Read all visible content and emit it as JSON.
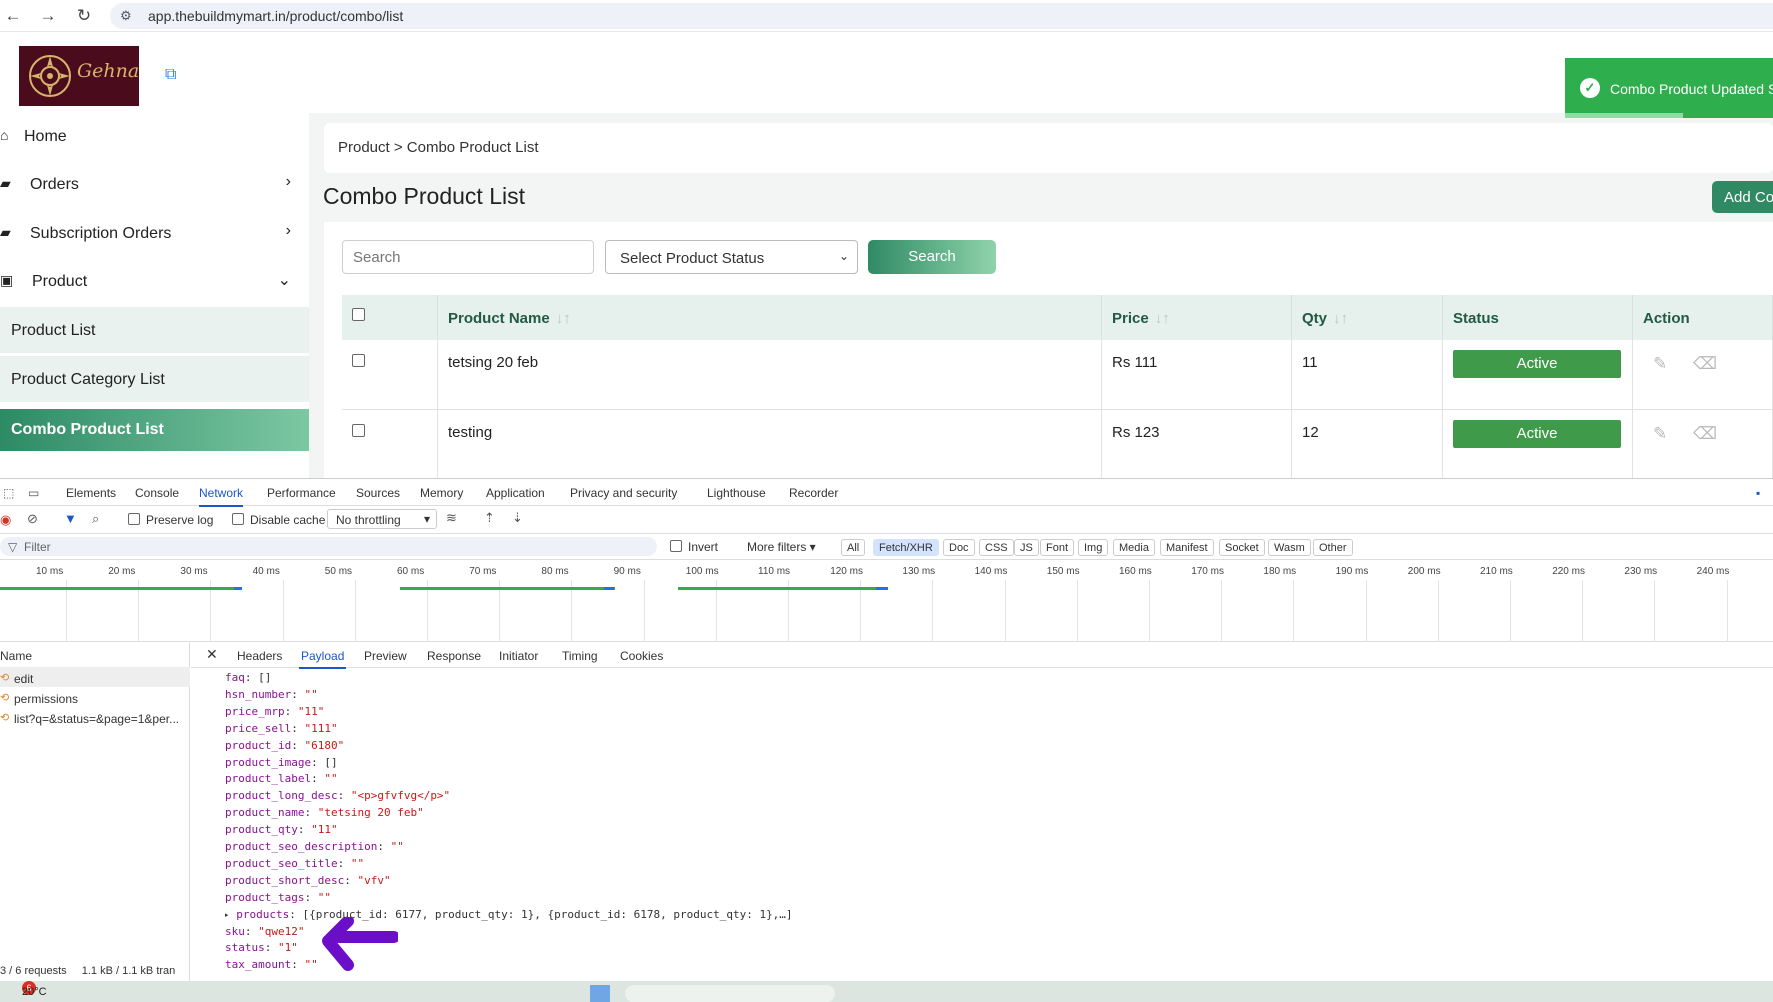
{
  "browser": {
    "url": "app.thebuildmymart.in/product/combo/list"
  },
  "logo": {
    "brand": "Gehna"
  },
  "sidebar": {
    "items": [
      {
        "label": "Home"
      },
      {
        "label": "Orders"
      },
      {
        "label": "Subscription Orders"
      },
      {
        "label": "Product"
      },
      {
        "label": "Product List"
      },
      {
        "label": "Product Category List"
      },
      {
        "label": "Combo Product List"
      }
    ]
  },
  "breadcrumb": "Product > Combo Product List",
  "page": {
    "title": "Combo Product List",
    "add_button": "Add Co"
  },
  "filters": {
    "search_placeholder": "Search",
    "status_select": "Select Product Status",
    "search_button": "Search"
  },
  "table": {
    "headers": [
      "Product Name",
      "Price",
      "Qty",
      "Status",
      "Action"
    ],
    "rows": [
      {
        "name": "tetsing 20 feb",
        "price": "Rs 111",
        "qty": "11",
        "status": "Active"
      },
      {
        "name": "testing",
        "price": "Rs 123",
        "qty": "12",
        "status": "Active"
      }
    ]
  },
  "toast": {
    "message": "Combo Product Updated S"
  },
  "devtools": {
    "tabs": [
      "Elements",
      "Console",
      "Network",
      "Performance",
      "Sources",
      "Memory",
      "Application",
      "Privacy and security",
      "Lighthouse",
      "Recorder"
    ],
    "toolbar": {
      "preserve_log": "Preserve log",
      "disable_cache": "Disable cache",
      "throttling": "No throttling"
    },
    "filter": {
      "placeholder": "Filter",
      "invert": "Invert",
      "more_filters": "More filters"
    },
    "type_chips": [
      "All",
      "Fetch/XHR",
      "Doc",
      "CSS",
      "JS",
      "Font",
      "Img",
      "Media",
      "Manifest",
      "Socket",
      "Wasm",
      "Other"
    ],
    "timeline_ticks": [
      "10 ms",
      "20 ms",
      "30 ms",
      "40 ms",
      "50 ms",
      "60 ms",
      "70 ms",
      "80 ms",
      "90 ms",
      "100 ms",
      "110 ms",
      "120 ms",
      "130 ms",
      "140 ms",
      "150 ms",
      "160 ms",
      "170 ms",
      "180 ms",
      "190 ms",
      "200 ms",
      "210 ms",
      "220 ms",
      "230 ms",
      "240 ms"
    ],
    "name_header": "Name",
    "requests": [
      "edit",
      "permissions",
      "list?q=&status=&page=1&per..."
    ],
    "status_bar": {
      "requests": "3 / 6 requests",
      "transferred": "1.1 kB / 1.1 kB tran"
    },
    "detail_tabs": [
      "Headers",
      "Payload",
      "Preview",
      "Response",
      "Initiator",
      "Timing",
      "Cookies"
    ],
    "payload": [
      {
        "key": "faq",
        "value": "[]",
        "kind": "plain"
      },
      {
        "key": "hsn_number",
        "value": "\"\"",
        "kind": "str"
      },
      {
        "key": "price_mrp",
        "value": "\"11\"",
        "kind": "str"
      },
      {
        "key": "price_sell",
        "value": "\"111\"",
        "kind": "str"
      },
      {
        "key": "product_id",
        "value": "\"6180\"",
        "kind": "str"
      },
      {
        "key": "product_image",
        "value": "[]",
        "kind": "plain"
      },
      {
        "key": "product_label",
        "value": "\"\"",
        "kind": "str"
      },
      {
        "key": "product_long_desc",
        "value": "\"<p>gfvfvg</p>\"",
        "kind": "str"
      },
      {
        "key": "product_name",
        "value": "\"tetsing 20 feb\"",
        "kind": "str"
      },
      {
        "key": "product_qty",
        "value": "\"11\"",
        "kind": "str"
      },
      {
        "key": "product_seo_description",
        "value": "\"\"",
        "kind": "str"
      },
      {
        "key": "product_seo_title",
        "value": "\"\"",
        "kind": "str"
      },
      {
        "key": "product_short_desc",
        "value": "\"vfv\"",
        "kind": "str"
      },
      {
        "key": "product_tags",
        "value": "\"\"",
        "kind": "str"
      },
      {
        "key": "products",
        "value": "[{product_id: 6177, product_qty: 1}, {product_id: 6178, product_qty: 1},…]",
        "kind": "plain"
      },
      {
        "key": "sku",
        "value": "\"qwe12\"",
        "kind": "str"
      },
      {
        "key": "status",
        "value": "\"1\"",
        "kind": "str"
      },
      {
        "key": "tax_amount",
        "value": "\"\"",
        "kind": "str"
      }
    ]
  },
  "taskbar": {
    "weather": "20°C",
    "badge": "6"
  },
  "colors": {
    "accent": "#2f8a64",
    "toast": "#2fae4e",
    "annotation_arrow": "#6a0fc7",
    "devtools_blue": "#1a57c7"
  }
}
